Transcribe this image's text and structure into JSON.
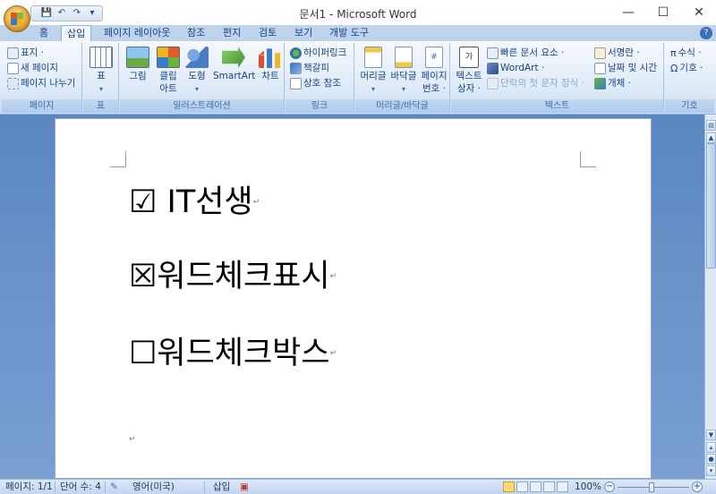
{
  "window": {
    "title": "문서1 - Microsoft Word",
    "minimize_icon": "—",
    "maximize_icon": "☐",
    "close_icon": "✕"
  },
  "qat": {
    "save": "💾",
    "undo": "↶",
    "redo": "↷",
    "customize": "▾"
  },
  "tabs": [
    {
      "label": "홈"
    },
    {
      "label": "삽입"
    },
    {
      "label": "페이지 레이아웃"
    },
    {
      "label": "참조"
    },
    {
      "label": "편지"
    },
    {
      "label": "검토"
    },
    {
      "label": "보기"
    },
    {
      "label": "개발 도구"
    }
  ],
  "active_tab": "삽입",
  "ribbon": {
    "page": {
      "label": "페이지",
      "cover": "표지 ·",
      "blank": "새 페이지",
      "break": "페이지 나누기"
    },
    "table": {
      "label": "표",
      "button": "표"
    },
    "illustrations": {
      "label": "일러스트레이션",
      "picture": "그림",
      "clipart_1": "클립",
      "clipart_2": "아트",
      "shapes": "도형",
      "smartart": "SmartArt",
      "chart": "차트"
    },
    "links": {
      "label": "링크",
      "hyperlink": "하이퍼링크",
      "bookmark": "책갈피",
      "crossref": "상호 참조"
    },
    "header_footer": {
      "label": "머리글/바닥글",
      "header": "머리글",
      "footer": "바닥글",
      "page_number_1": "페이지",
      "page_number_2": "번호 ·"
    },
    "text": {
      "label": "텍스트",
      "textbox_1": "텍스트",
      "textbox_2": "상자 ·",
      "quickparts": "빠른 문서 요소 ·",
      "wordart": "WordArt ·",
      "dropcap": "단락의 첫 문자 장식 ·",
      "signature": "서명란 ·",
      "datetime": "날짜 및 시간",
      "object": "개체 ·"
    },
    "symbols": {
      "label": "기호",
      "equation": "수식 ·",
      "symbol": "기호 ·"
    }
  },
  "document": {
    "lines": [
      "☑ IT선생",
      "☒워드체크표시",
      "☐워드체크박스"
    ],
    "paragraph_mark": "↵"
  },
  "status": {
    "page": "페이지: 1/1",
    "words": "단어 수: 4",
    "language": "영어(미국)",
    "mode": "삽입",
    "zoom": "100%",
    "zoom_out": "−",
    "zoom_in": "+"
  },
  "colors": {
    "ribbon_bg": "#dde9f7",
    "tab_text": "#15428b",
    "doc_bg": "#6b93c5"
  }
}
